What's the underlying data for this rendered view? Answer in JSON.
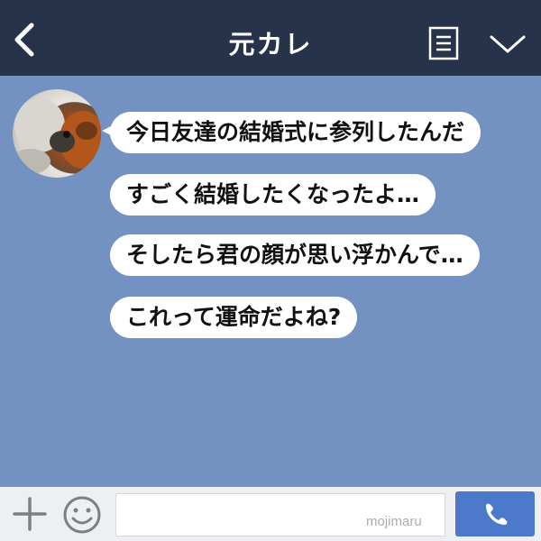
{
  "header": {
    "title": "元カレ",
    "back_icon": "chevron-left-icon",
    "menu_icon": "notes-icon",
    "dropdown_icon": "chevron-down-icon"
  },
  "chat": {
    "messages": [
      "今日友達の結婚式に参列したんだ",
      "すごく結婚したくなったよ…",
      "そしたら君の顔が思い浮かんで…",
      "これって運命だよね?"
    ]
  },
  "footer": {
    "input_value": "",
    "watermark": "mojimaru",
    "plus_icon": "plus-icon",
    "emoji_icon": "smiley-icon",
    "call_icon": "phone-icon"
  },
  "colors": {
    "header_bg": "#26334a",
    "chat_bg": "#7392c2",
    "bubble_bg": "#ffffff",
    "call_button": "#4c79c9"
  }
}
